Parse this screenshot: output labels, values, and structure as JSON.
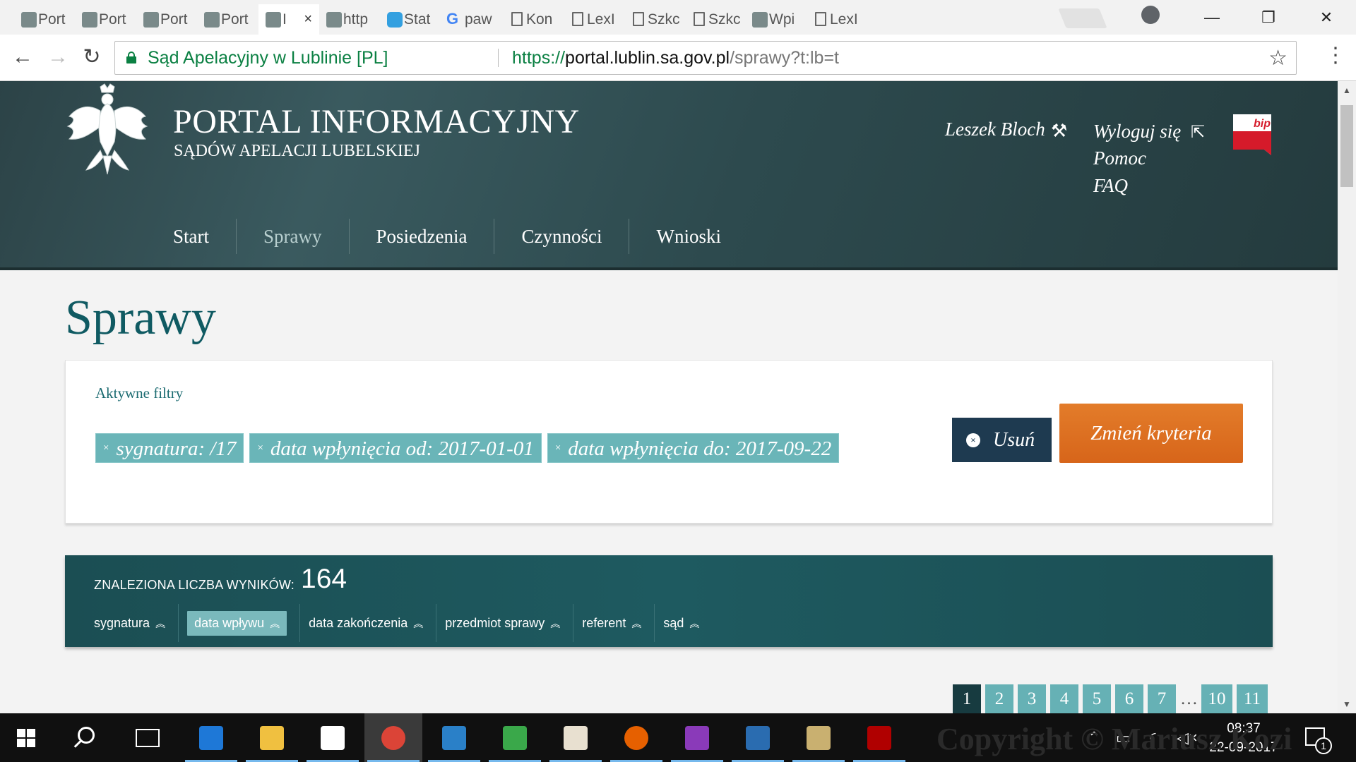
{
  "browser": {
    "tabs": [
      {
        "label": "Port",
        "icon": "eagle-favicon"
      },
      {
        "label": "Port",
        "icon": "eagle-favicon"
      },
      {
        "label": "Port",
        "icon": "eagle-favicon"
      },
      {
        "label": "Port",
        "icon": "eagle-favicon"
      },
      {
        "label": "I",
        "icon": "eagle-favicon",
        "active": true
      },
      {
        "label": "http",
        "icon": "eagle-favicon"
      },
      {
        "label": "Stat",
        "icon": "stat-favicon"
      },
      {
        "label": "paw",
        "icon": "google-favicon"
      },
      {
        "label": "Kon",
        "icon": "doc-favicon"
      },
      {
        "label": "LexI",
        "icon": "doc-favicon"
      },
      {
        "label": "Szkc",
        "icon": "doc-favicon"
      },
      {
        "label": "Szkc",
        "icon": "doc-favicon"
      },
      {
        "label": "Wpi",
        "icon": "tree-favicon"
      },
      {
        "label": "LexI",
        "icon": "doc-favicon"
      }
    ],
    "tab_close": "×",
    "window_controls": {
      "minimize": "—",
      "restore": "❐",
      "close": "✕"
    },
    "address": {
      "site_name": "Sąd Apelacyjny w Lublinie [PL]",
      "scheme": "https://",
      "host": "portal.lublin.sa.gov.pl",
      "path": "/sprawy?t:lb=t"
    },
    "nav": {
      "back": "←",
      "forward": "→",
      "reload": "↻",
      "star": "☆",
      "menu": "⋮"
    }
  },
  "header": {
    "title": "PORTAL INFORMACYJNY",
    "subtitle": "SĄDÓW APELACJI LUBELSKIEJ",
    "user_name": "Leszek Bloch",
    "user_tools_icon": "⚒",
    "links": {
      "logout": "Wyloguj się",
      "help": "Pomoc",
      "faq": "FAQ"
    },
    "logout_icon": "⇱",
    "bip_label": "bip",
    "nav": [
      {
        "label": "Start",
        "active": false
      },
      {
        "label": "Sprawy",
        "active": true
      },
      {
        "label": "Posiedzenia",
        "active": false
      },
      {
        "label": "Czynności",
        "active": false
      },
      {
        "label": "Wnioski",
        "active": false
      }
    ]
  },
  "main": {
    "page_title": "Sprawy",
    "filters": {
      "label": "Aktywne filtry",
      "chips": [
        "sygnatura: /17",
        "data wpłynięcia od: 2017-01-01",
        "data wpłynięcia do: 2017-09-22"
      ],
      "chip_remove": "×",
      "remove_button": "Usuń",
      "remove_icon": "×",
      "change_button": "Zmień kryteria"
    },
    "results": {
      "label": "ZNALEZIONA LICZBA WYNIKÓW:",
      "count": "164",
      "sort_columns": [
        {
          "label": "sygnatura",
          "active": false
        },
        {
          "label": "data wpływu",
          "active": true
        },
        {
          "label": "data zakończenia",
          "active": false
        },
        {
          "label": "przedmiot sprawy",
          "active": false
        },
        {
          "label": "referent",
          "active": false
        },
        {
          "label": "sąd",
          "active": false
        }
      ],
      "sort_icon": "⌃"
    },
    "pagination": {
      "pages": [
        "1",
        "2",
        "3",
        "4",
        "5",
        "6",
        "7"
      ],
      "ellipsis": "…",
      "tail": [
        "10",
        "11"
      ],
      "current": "1"
    }
  },
  "taskbar": {
    "apps": [
      {
        "name": "edge",
        "color": "#1e78d7"
      },
      {
        "name": "file-explorer",
        "color": "#f0c040"
      },
      {
        "name": "store",
        "color": "#ffffff"
      },
      {
        "name": "chrome",
        "color": "#db4437",
        "active": true
      },
      {
        "name": "writer",
        "color": "#2a80c8"
      },
      {
        "name": "calc",
        "color": "#3aa84a"
      },
      {
        "name": "java",
        "color": "#e8e0d0"
      },
      {
        "name": "firefox",
        "color": "#e66000"
      },
      {
        "name": "app-purple",
        "color": "#8a3ab9"
      },
      {
        "name": "app-eagle",
        "color": "#2a6cb0"
      },
      {
        "name": "app-mail",
        "color": "#c9b070"
      },
      {
        "name": "acrobat",
        "color": "#b00000"
      }
    ],
    "clock_time": "08:37",
    "clock_date": "22-09-2017",
    "notification_count": "1",
    "watermark": "Copyright © Mariusz Kozi"
  }
}
